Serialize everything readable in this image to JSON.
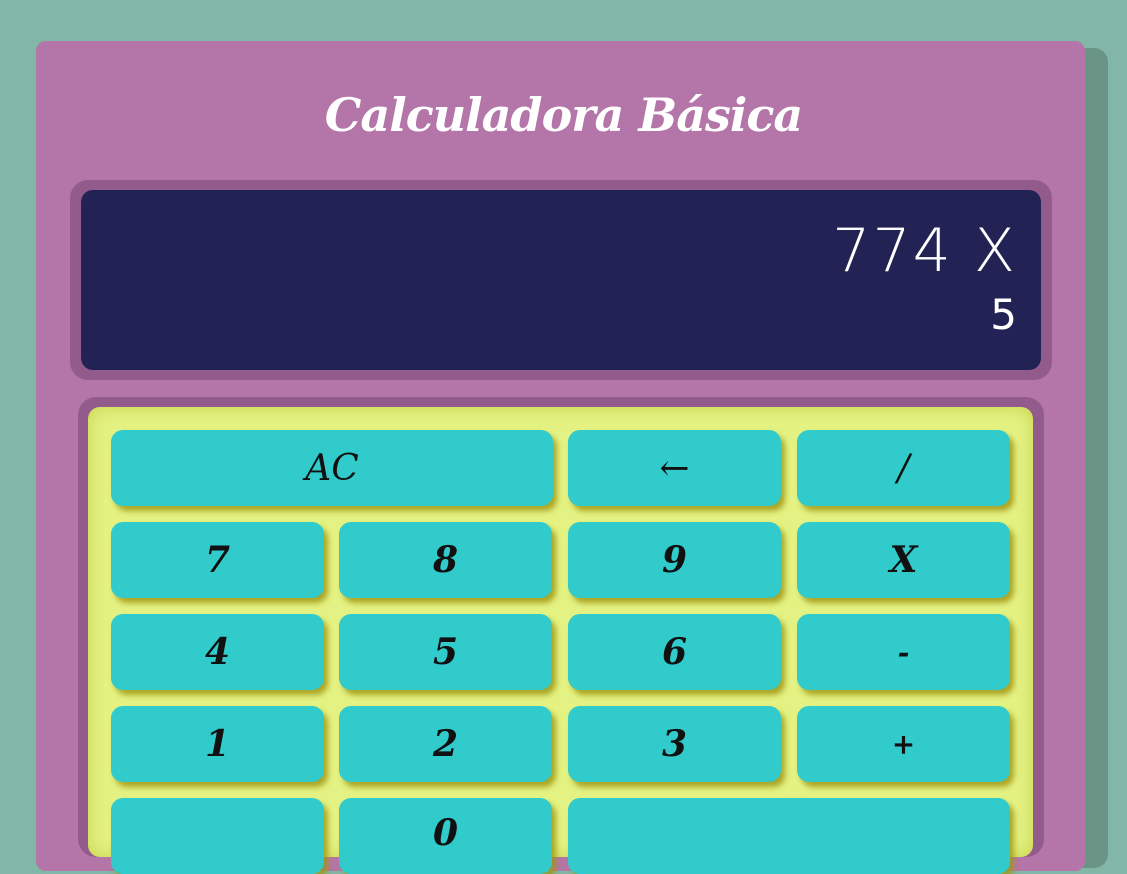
{
  "title": "Calculadora Básica",
  "display": {
    "expression": "774 X",
    "current": "5"
  },
  "keys": {
    "ac": "AC",
    "backspace": "←",
    "divide": "/",
    "seven": "7",
    "eight": "8",
    "nine": "9",
    "multiply": "X",
    "four": "4",
    "five": "5",
    "six": "6",
    "minus": "-",
    "one": "1",
    "two": "2",
    "three": "3",
    "plus": "+",
    "zero": "0"
  }
}
